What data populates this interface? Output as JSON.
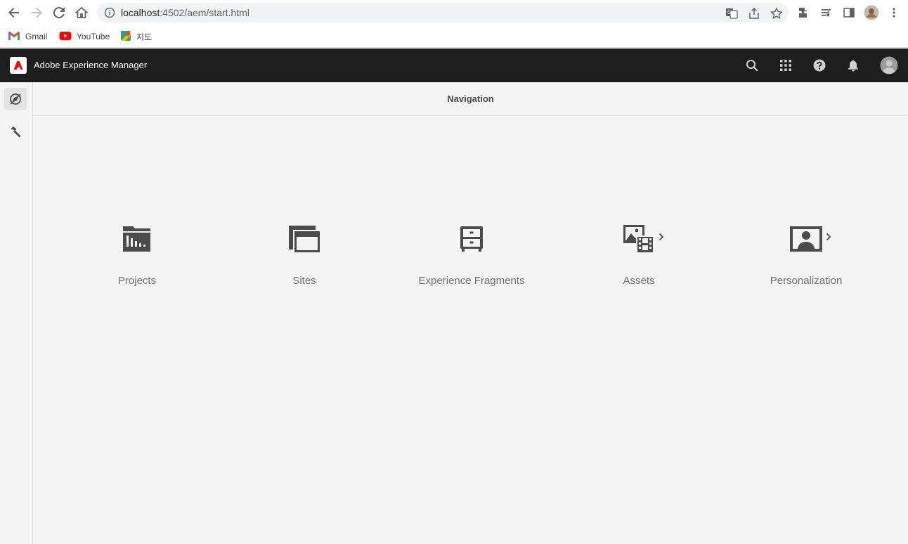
{
  "browser": {
    "url_host": "localhost",
    "url_rest": ":4502/aem/start.html",
    "bookmarks": [
      {
        "label": "Gmail",
        "icon": "gmail-icon"
      },
      {
        "label": "YouTube",
        "icon": "youtube-icon"
      },
      {
        "label": "지도",
        "icon": "maps-icon"
      }
    ]
  },
  "header": {
    "title": "Adobe Experience Manager",
    "icons": [
      "search-icon",
      "apps-grid-icon",
      "help-icon",
      "bell-icon",
      "avatar-icon"
    ]
  },
  "rail": {
    "items": [
      "navigation-compass-icon",
      "tools-hammer-icon"
    ]
  },
  "main": {
    "title": "Navigation",
    "tiles": [
      {
        "label": "Projects",
        "icon": "projects-icon"
      },
      {
        "label": "Sites",
        "icon": "sites-icon"
      },
      {
        "label": "Experience Fragments",
        "icon": "experience-fragments-icon"
      },
      {
        "label": "Assets",
        "icon": "assets-icon"
      },
      {
        "label": "Personalization",
        "icon": "personalization-icon"
      }
    ]
  },
  "colors": {
    "header_bg": "#1e1e1e",
    "icon_dark": "#4b4b4b",
    "adobe_red": "#eb1000"
  }
}
